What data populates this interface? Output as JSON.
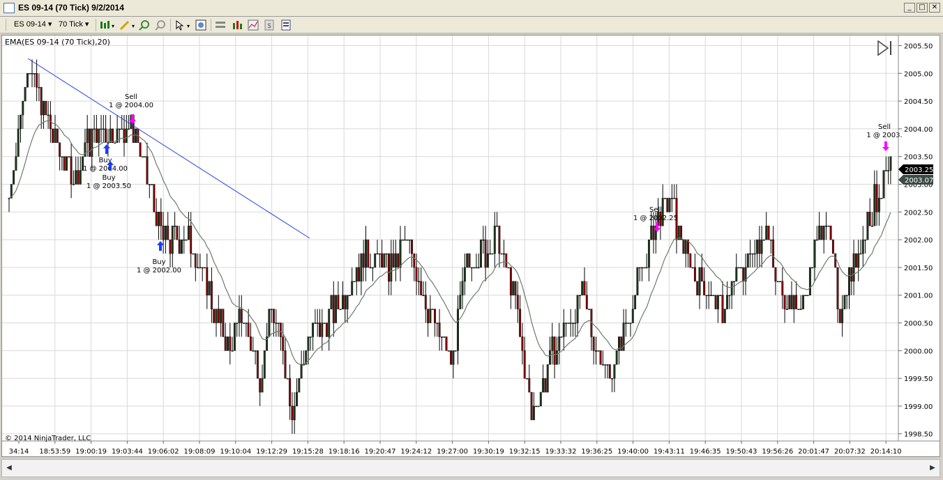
{
  "window": {
    "title": "ES 09-14 (70 Tick)  9/2/2014"
  },
  "toolbar": {
    "instrument": "ES 09-14",
    "period": "70 Tick"
  },
  "chart": {
    "indicator_label": "EMA(ES 09-14 (70 Tick),20)",
    "copyright": "© 2014 NinjaTrader, LLC",
    "y_labels": [
      "2005.50",
      "2005.00",
      "2004.50",
      "2004.00",
      "2003.50",
      "2003.00",
      "2002.50",
      "2002.00",
      "2001.50",
      "2001.00",
      "2000.50",
      "2000.00",
      "1999.50",
      "1999.00",
      "1998.50"
    ],
    "x_labels": [
      "34:14",
      "18:53:59",
      "19:00:19",
      "19:03:44",
      "19:06:02",
      "19:08:09",
      "19:10:04",
      "19:12:29",
      "19:15:28",
      "19:18:16",
      "19:20:47",
      "19:24:12",
      "19:27:00",
      "19:30:19",
      "19:32:15",
      "19:33:32",
      "19:36:25",
      "19:40:00",
      "19:43:11",
      "19:46:35",
      "19:50:43",
      "19:56:26",
      "20:01:47",
      "20:07:32",
      "20:14:10"
    ],
    "last_price": "2003.25",
    "ema_value": "2003.07",
    "markers": [
      {
        "t1": "Sell",
        "t2": "1 @ 2004.00"
      },
      {
        "t1": "Buy",
        "t2": "1 @ 2004.00"
      },
      {
        "t1": "Buy",
        "t2": "1 @ 2003.50"
      },
      {
        "t1": "Buy",
        "t2": "1 @ 2002.00"
      },
      {
        "t1": "Sell",
        "t2": "1 @ 2002.25"
      },
      {
        "t1": "Sell",
        "t2": "1 @ 2003."
      }
    ]
  },
  "colors": {
    "up": "#1d3a1d",
    "down": "#8b0000",
    "ema": "#6b7b6b",
    "trendline": "#1f3fe0",
    "grid": "#d8d8d8",
    "sell": "#ff00ff",
    "buy": "#1a3cff"
  }
}
